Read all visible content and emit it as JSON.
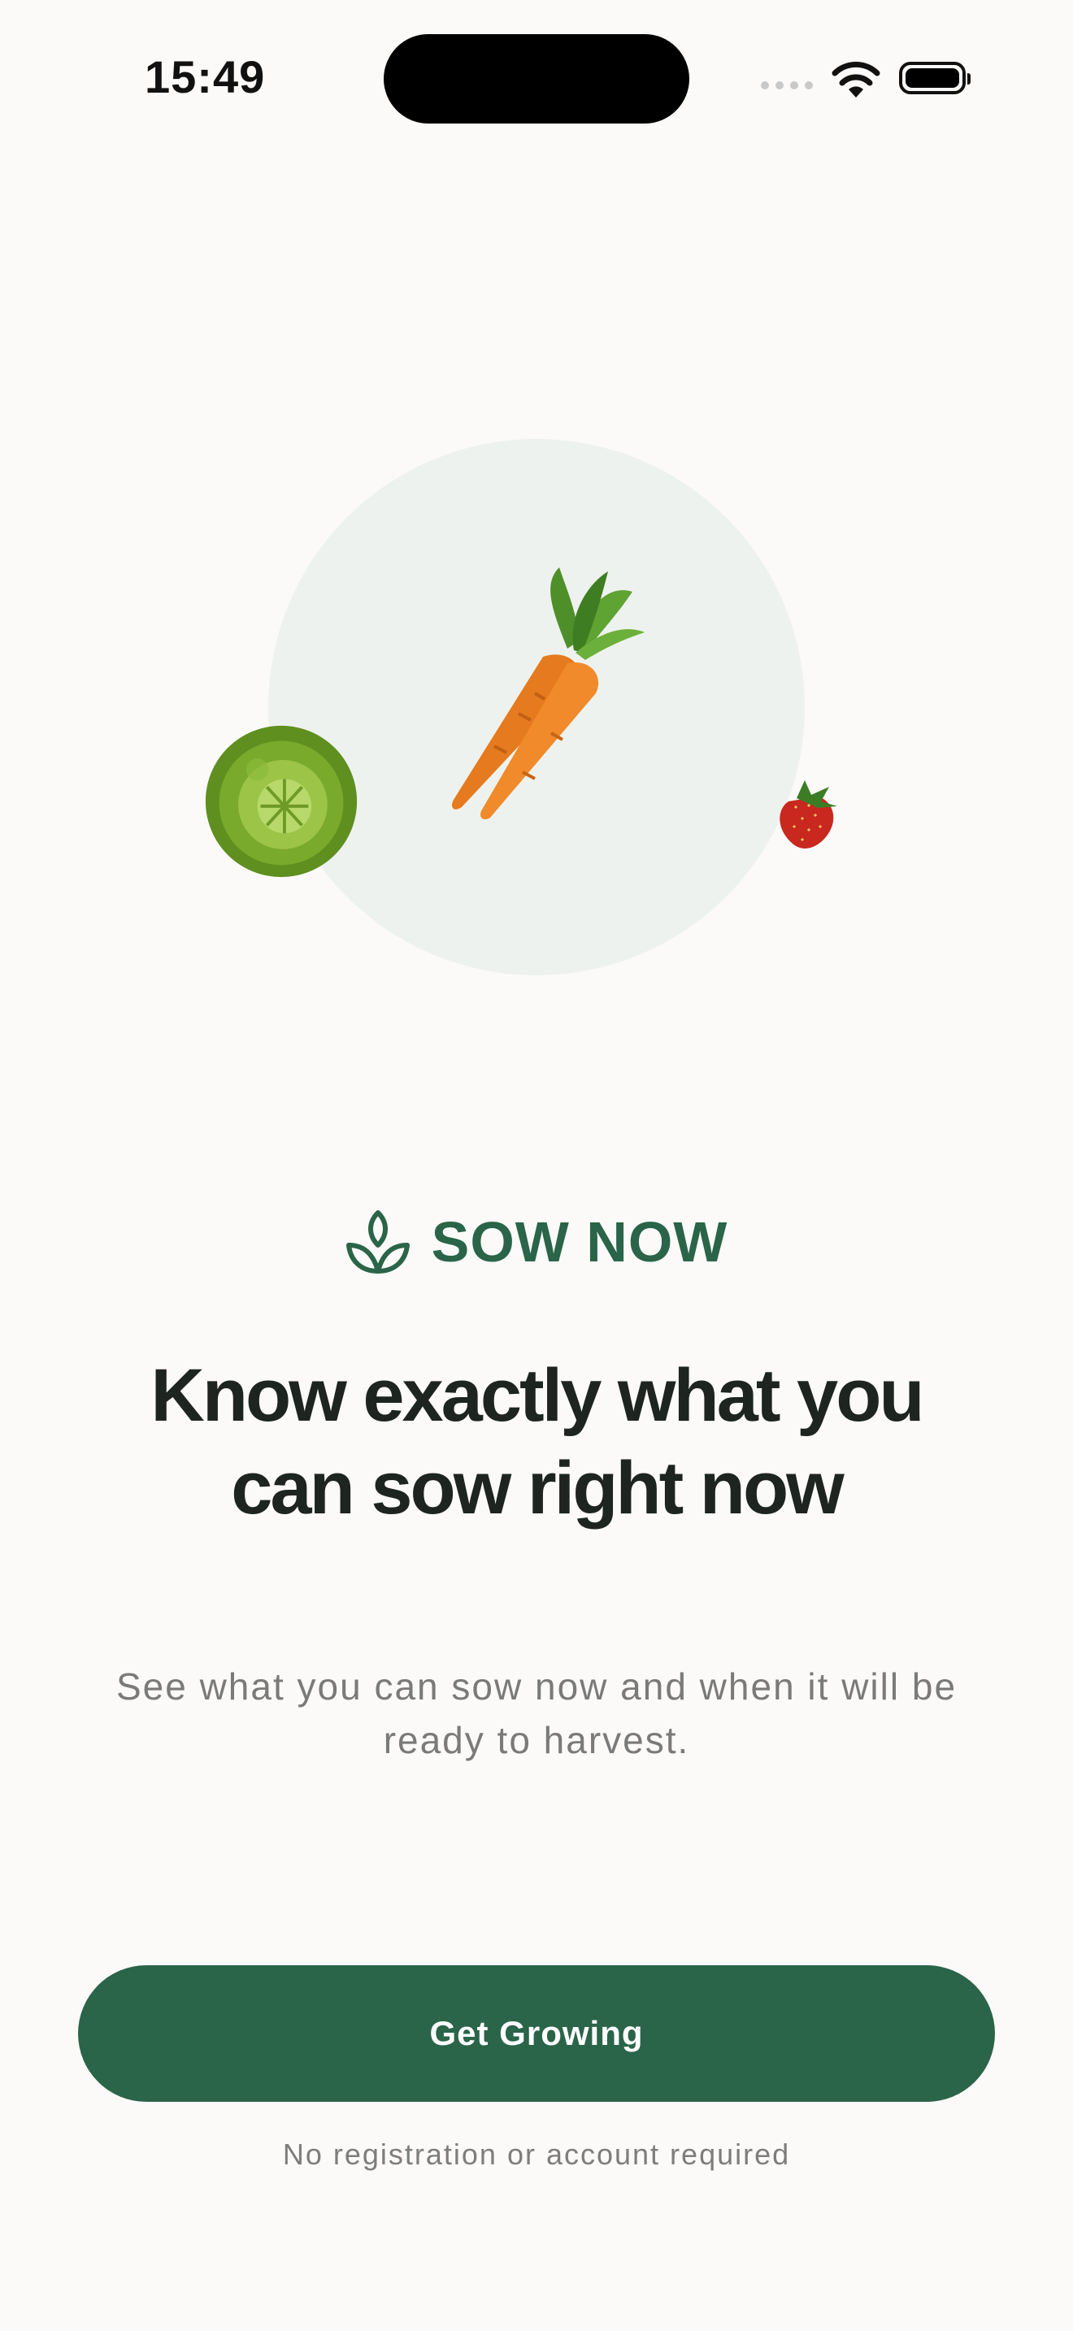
{
  "status_bar": {
    "time": "15:49"
  },
  "illustration": {
    "items": [
      "cabbage-icon",
      "carrot-icon",
      "strawberry-icon"
    ]
  },
  "feature": {
    "icon": "sprout-icon",
    "label": "SOW NOW"
  },
  "headline": "Know exactly what you can sow right now",
  "subtitle": "See what you can sow now and when it will be ready to harvest.",
  "cta": {
    "label": "Get Growing"
  },
  "note": "No registration or account required",
  "colors": {
    "accent": "#2a6449",
    "background": "#fbfaf8",
    "circle": "#eef2ee"
  }
}
